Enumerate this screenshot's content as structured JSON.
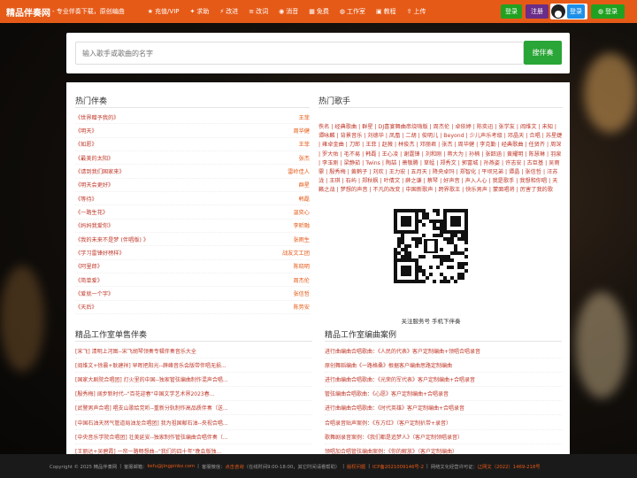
{
  "header": {
    "logo": "精品伴奏网",
    "tagline": " - 专业伴奏下载，原创编曲",
    "nav": [
      {
        "icon": "vip-icon",
        "glyph": "★",
        "label": "充值/VIP"
      },
      {
        "icon": "request-icon",
        "glyph": "✦",
        "label": "求助"
      },
      {
        "icon": "bolt-icon",
        "glyph": "⚡",
        "label": "改进"
      },
      {
        "icon": "list-icon",
        "glyph": "≡",
        "label": "改词"
      },
      {
        "icon": "vocal-remove-icon",
        "glyph": "◉",
        "label": "消音"
      },
      {
        "icon": "free-icon",
        "glyph": "▦",
        "label": "免费"
      },
      {
        "icon": "studio-icon",
        "glyph": "◍",
        "label": "工作室"
      },
      {
        "icon": "tutorial-icon",
        "glyph": "▣",
        "label": "教程"
      },
      {
        "icon": "upload-icon",
        "glyph": "⇪",
        "label": "上传"
      }
    ],
    "login": "登录",
    "register": "注册",
    "qq_login": "登录",
    "wechat_login": "登录"
  },
  "search": {
    "placeholder": "输入歌手或歌曲的名字",
    "button": "搜伴奏"
  },
  "hot_songs": {
    "title": "热门伴奏",
    "items": [
      {
        "song": "《世界赠予我的》",
        "artist": "王菲"
      },
      {
        "song": "《明天》",
        "artist": "周华健"
      },
      {
        "song": "《如愿》",
        "artist": "王菲"
      },
      {
        "song": "《最美的太阳》",
        "artist": "张杰"
      },
      {
        "song": "《请到我们国家来》",
        "artist": "雷岭佳人"
      },
      {
        "song": "《明天会更好》",
        "artist": "群星"
      },
      {
        "song": "《等待》",
        "artist": "韩磊"
      },
      {
        "song": "《一路生花》",
        "artist": "温奕心"
      },
      {
        "song": "《妈妈我爱你》",
        "artist": "李昕融"
      },
      {
        "song": "《我的未来不是梦 (伴唱版) 》",
        "artist": "张雨生"
      },
      {
        "song": "《学习雷锋好榜样》",
        "artist": "战友文工团"
      },
      {
        "song": "《阿里郎》",
        "artist": "陈晓明"
      },
      {
        "song": "《简单爱》",
        "artist": "周杰伦"
      },
      {
        "song": "《爱就一个字》",
        "artist": "张信哲"
      },
      {
        "song": "《天后》",
        "artist": "陈势安"
      }
    ]
  },
  "hot_singers": {
    "title": "热门歌手",
    "text": "佚名 | 经典歌曲 | 群星 | DJ喜宴舞曲串烧嗨版 | 周杰伦 | 卓依婷 | 陈奕迅 | 张学友 | 阎维文 | 未知 | 谭咏麟 | 背景音乐 | 刘德华 | 凤凰 | 二胡 | 俊明儿 | Beyond | 少儿声乐考级 | 邓晶天 | 合唱 | 苏星婕 | 雍卓金曲 | 刀郎 | 王菲 | 赵薇 | 林俊杰 | 邓丽君 | 张杰 | 周华健 | 李克勤 | 经典歌曲 | 任贤齐 | 周深 | 罗大佑 | 毛不易 | 韩磊 | 王心凌 | 谢霆锋 | 刘和刚 | 蒋大为 | 孙楠 | 张韶涵 | 黄耀明 | 陈慧琳 | 羽泉 | 李玉刚 | 梁静茹 | Twins | 陶喆 | 萧敬腾 | 草蜢 | 郑秀文 | 郭富城 | 孙燕姿 | 许志安 | 古巨基 | 吴雨霏 | 殷秀梅 | 黄鹤子 | 刘欢 | 王力宏 | 五月天 | 降央卓玛 | 郑智化 | 平坝兄弟 | 谭晶 | 张信哲 | 汪苏泷 | 王琪 | 石屿 | 郑秋枫 | 叶倩文 | 薛之谦 | 蔡琴 | 好声音 | 声入人心 | 我是歌手 | 我想和你唱 | 天籁之战 | 梦想的声音 | 不凡的改变 | 中国新歌声 | 跨界歌王 | 快乐男声 | 蒙面唱将 | 厉害了我的歌"
  },
  "qr": {
    "caption": "关注服务号 手机下伴奏"
  },
  "solo_cases": {
    "title": "精品工作室单售伴奏",
    "items": [
      "[宋飞] 清明上河图--宋飞胡琴领奏专辑伴奏音乐大全",
      "[阎维文+徐晨+耿建祥] 早晖把阳光--薛峰音乐会版带伴唱无损...",
      "[国家大剧院合唱团] 灯火里的中国--独家管弦编曲制作混声合唱...",
      "[殷秀梅] 阔步新时代--\"百花迎春\"中国文学艺术界2023春...",
      "[武警男声合唱] 唱支山歌给党听--重新分轨制作高品质伴奏（送...",
      "[中国石油天然气管道局油龙合唱团] 我为祖国献石油--央视合唱...",
      "[中央音乐学院合唱团] 壮美延安--独家制作管弦编曲合唱伴奏（...",
      "[王丽达+吴碧霞] 一帘一路畅想曲--\"我们的四十年\"晚会版独..."
    ]
  },
  "arrangement_cases": {
    "title": "精品工作室编曲案例",
    "items": [
      "进行曲编曲合唱歌曲：《人民的代表》客户定制编曲+领唱合唱录音",
      "原创舞蹈编曲《一路格桑》根据客户编曲思路定制编曲",
      "进行曲编曲合唱歌曲：《光荣的军代表》客户定制编曲+合唱录音",
      "管弦编曲合唱歌曲：《心愿》客户定制编曲+合唱录音",
      "进行曲编曲合唱歌曲：《时代英雄》客户定制编曲+合唱录音",
      "合唱录音贴声案例：《东方红》（客户定制扒带+录音）",
      "歌舞剧录音案例：《我们都是追梦人》（客户定制领唱录音）",
      "领唱加合唱管弦编曲案例：《你的解放》（客户定制编曲）"
    ]
  },
  "footer": {
    "copyright": "Copyright © 2025 精品伴奏网",
    "service_label": "客服邮箱：",
    "service_email": "kefu@jingpinbz.com",
    "wechat_label": "客服微信：",
    "wechat_value": "点击咨询",
    "hours": "（在线时间9:00-18:00，其它时间请看帮助）",
    "copyright_notice": "版权问题",
    "icp": "ICP备2021009146号-2",
    "culture": "网络文化经营许可证：",
    "license": "辽网文（2022）1469-218号"
  },
  "colors": {
    "brand": "#e65a17",
    "green": "#21a121",
    "purple": "#6a2d88",
    "blue": "#1d8fe8",
    "link_red": "#c0392b"
  }
}
